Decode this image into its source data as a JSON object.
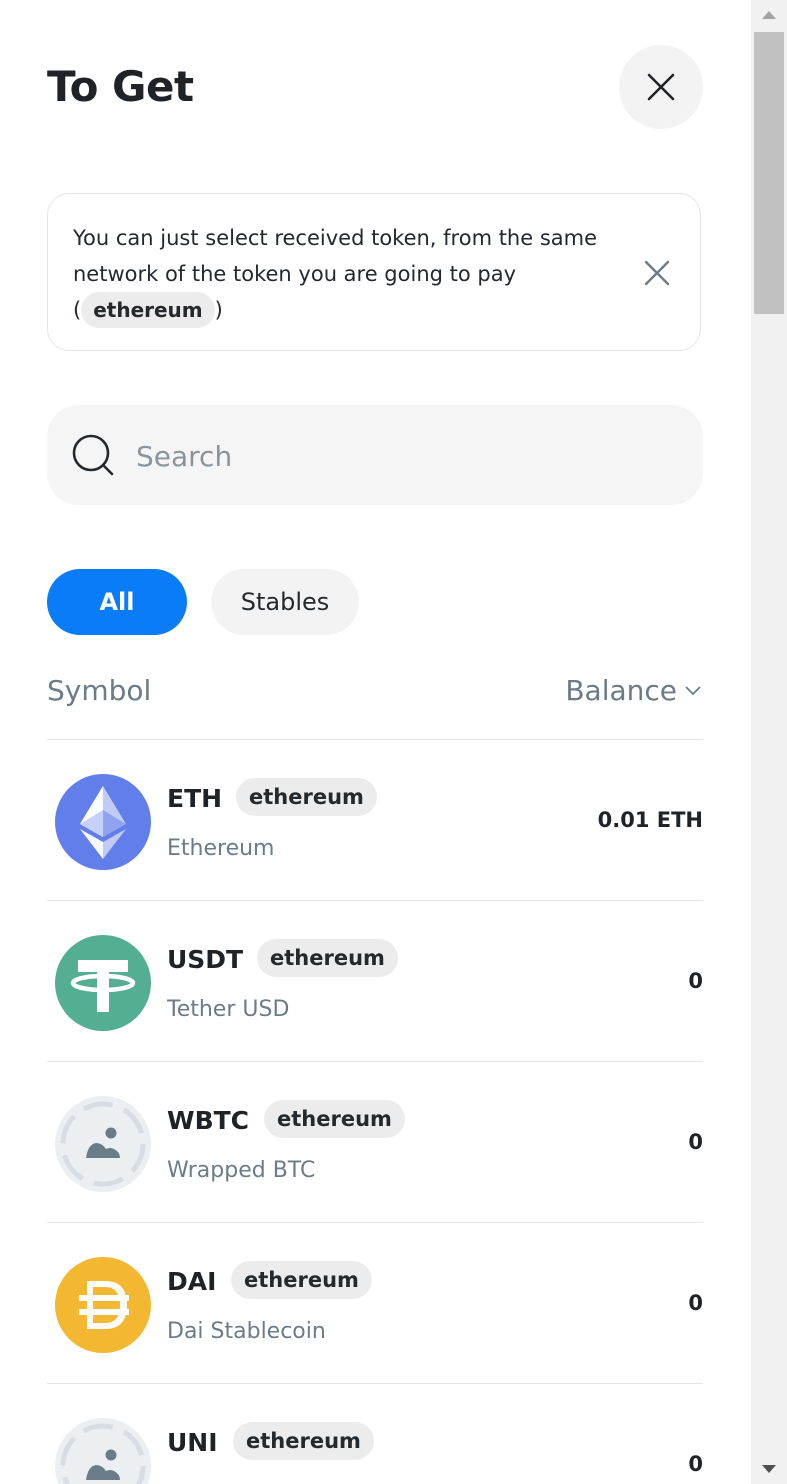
{
  "header": {
    "title": "To Get",
    "close_icon": "close-icon"
  },
  "info": {
    "text": "You can just select received token, from the same network of the token you are going to pay",
    "open_paren": "(",
    "network": "ethereum",
    "close_paren": ")",
    "close_icon": "close-icon"
  },
  "search": {
    "placeholder": "Search",
    "value": "",
    "icon": "search-icon"
  },
  "filters": {
    "all": "All",
    "stables": "Stables",
    "active": "All",
    "active_color": "#0a7cf7"
  },
  "columns": {
    "symbol": "Symbol",
    "balance": "Balance"
  },
  "tokens": [
    {
      "symbol": "ETH",
      "network": "ethereum",
      "name": "Ethereum",
      "balance": "0.01 ETH",
      "icon": "ethereum-logo",
      "color": "#627eea"
    },
    {
      "symbol": "USDT",
      "network": "ethereum",
      "name": "Tether USD",
      "balance": "0",
      "icon": "tether-logo",
      "color": "#53ae94"
    },
    {
      "symbol": "WBTC",
      "network": "ethereum",
      "name": "Wrapped BTC",
      "balance": "0",
      "icon": "placeholder-image-icon",
      "color": "#eceff2"
    },
    {
      "symbol": "DAI",
      "network": "ethereum",
      "name": "Dai Stablecoin",
      "balance": "0",
      "icon": "dai-logo",
      "color": "#f4b731"
    },
    {
      "symbol": "UNI",
      "network": "ethereum",
      "name": "",
      "balance": "0",
      "icon": "placeholder-image-icon",
      "color": "#eceff2"
    }
  ]
}
